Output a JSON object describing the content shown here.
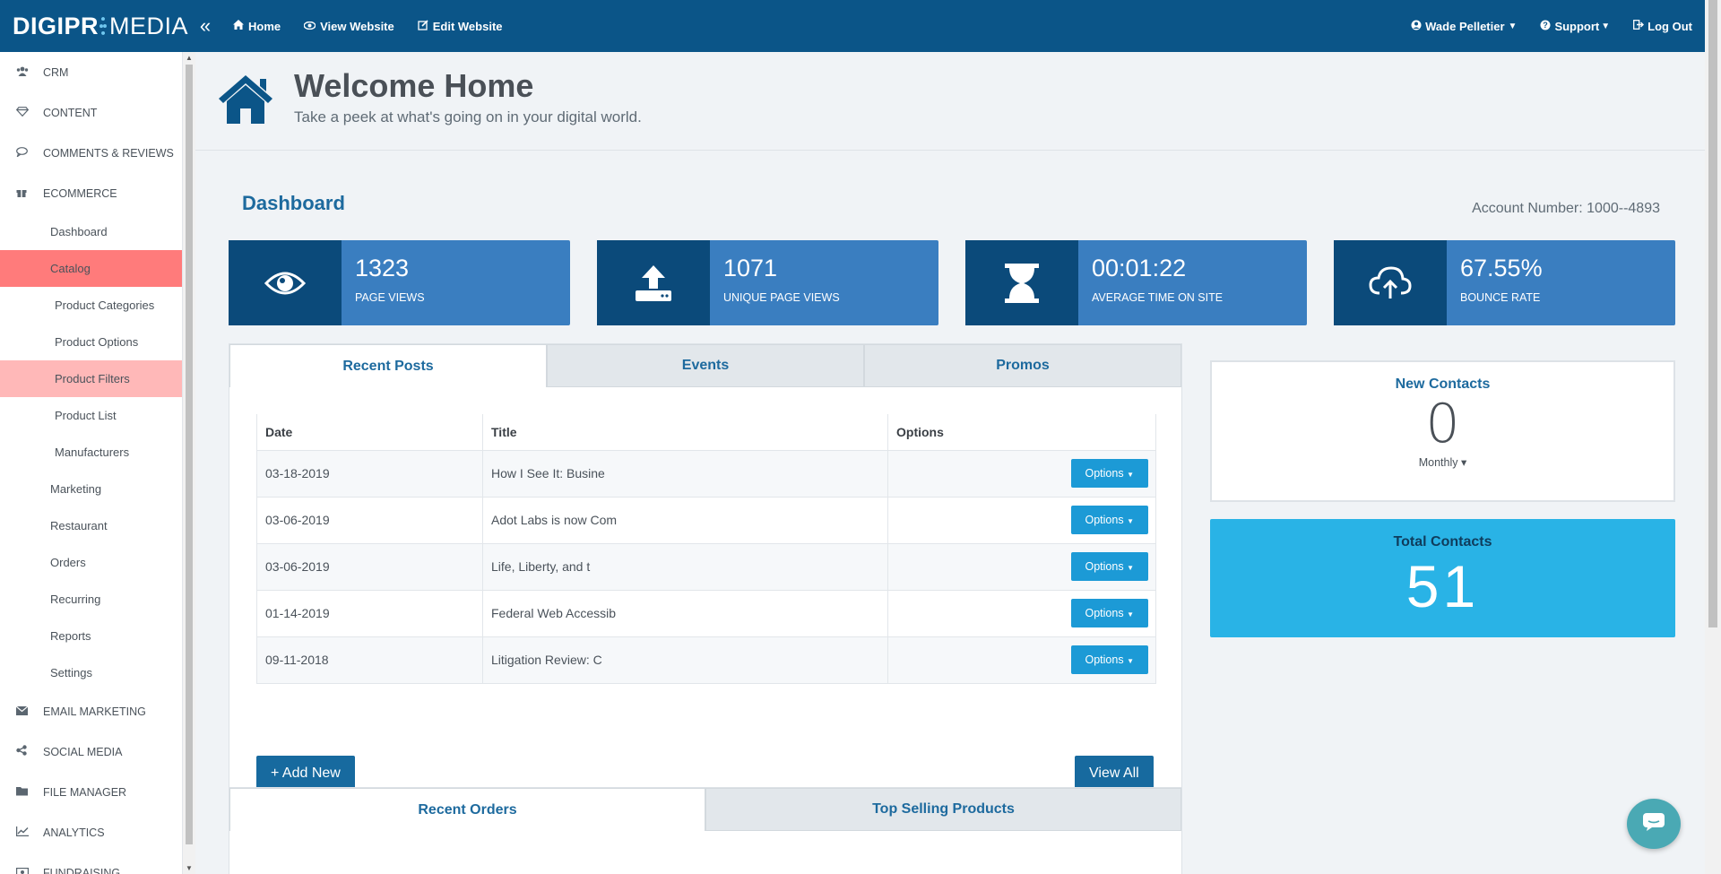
{
  "topbar": {
    "logo_bold": "DIGIPR",
    "logo_light": "MEDIA",
    "collapse": "«",
    "nav": [
      {
        "label": "Home",
        "icon": "home-icon"
      },
      {
        "label": "View Website",
        "icon": "eye-icon"
      },
      {
        "label": "Edit Website",
        "icon": "edit-icon"
      }
    ],
    "user": "Wade Pelletier",
    "support": "Support",
    "logout": "Log Out"
  },
  "sidebar": {
    "top_items": [
      {
        "label": "CRM",
        "icon": "users-icon"
      },
      {
        "label": "CONTENT",
        "icon": "diamond-icon"
      },
      {
        "label": "COMMENTS & REVIEWS",
        "icon": "comment-icon"
      },
      {
        "label": "ECOMMERCE",
        "icon": "gift-icon"
      }
    ],
    "ecommerce_items": [
      "Dashboard",
      "Catalog"
    ],
    "catalog_items": [
      "Product Categories",
      "Product Options",
      "Product Filters",
      "Product List",
      "Manufacturers"
    ],
    "more_items": [
      "Marketing",
      "Restaurant",
      "Orders",
      "Recurring",
      "Reports",
      "Settings"
    ],
    "bottom_items": [
      {
        "label": "EMAIL MARKETING",
        "icon": "envelope-icon"
      },
      {
        "label": "SOCIAL MEDIA",
        "icon": "share-icon"
      },
      {
        "label": "FILE MANAGER",
        "icon": "folder-icon"
      },
      {
        "label": "ANALYTICS",
        "icon": "chart-icon"
      },
      {
        "label": "FUNDRAISING",
        "icon": "money-icon"
      }
    ]
  },
  "header": {
    "title": "Welcome Home",
    "subtitle": "Take a peek at what's going on in your digital world."
  },
  "dashboard": {
    "title": "Dashboard",
    "account": "Account Number: 1000--4893",
    "stats": [
      {
        "value": "1323",
        "label": "PAGE VIEWS",
        "icon": "eye-icon"
      },
      {
        "value": "1071",
        "label": "UNIQUE PAGE VIEWS",
        "icon": "upload-icon"
      },
      {
        "value": "00:01:22",
        "label": "AVERAGE TIME ON SITE",
        "icon": "hourglass-icon"
      },
      {
        "value": "67.55%",
        "label": "BOUNCE RATE",
        "icon": "cloud-upload-icon"
      }
    ]
  },
  "posts_panel": {
    "tabs": [
      "Recent Posts",
      "Events",
      "Promos"
    ],
    "columns": [
      "Date",
      "Title",
      "Options"
    ],
    "rows": [
      {
        "date": "03-18-2019",
        "title": "How I See It: Busine",
        "option": "Options"
      },
      {
        "date": "03-06-2019",
        "title": "Adot Labs is now Com",
        "option": "Options"
      },
      {
        "date": "03-06-2019",
        "title": "Life, Liberty, and t",
        "option": "Options"
      },
      {
        "date": "01-14-2019",
        "title": "Federal Web Accessib",
        "option": "Options"
      },
      {
        "date": "09-11-2018",
        "title": "Litigation Review: C",
        "option": "Options"
      }
    ],
    "add_new": "+ Add New",
    "view_all": "View All"
  },
  "orders_panel": {
    "tabs": [
      "Recent Orders",
      "Top Selling Products"
    ]
  },
  "contacts": {
    "new_title": "New Contacts",
    "new_value": "0",
    "period": "Monthly ▾",
    "total_title": "Total Contacts",
    "total_value": "51"
  },
  "colors": {
    "topbar": "#0b5588",
    "stat_bg": "#3a7ec0",
    "stat_icon_bg": "#0b4a7a",
    "accent": "#1c9ad6",
    "total_contacts": "#29b3e6",
    "active_nav": "#ff7b7b"
  }
}
